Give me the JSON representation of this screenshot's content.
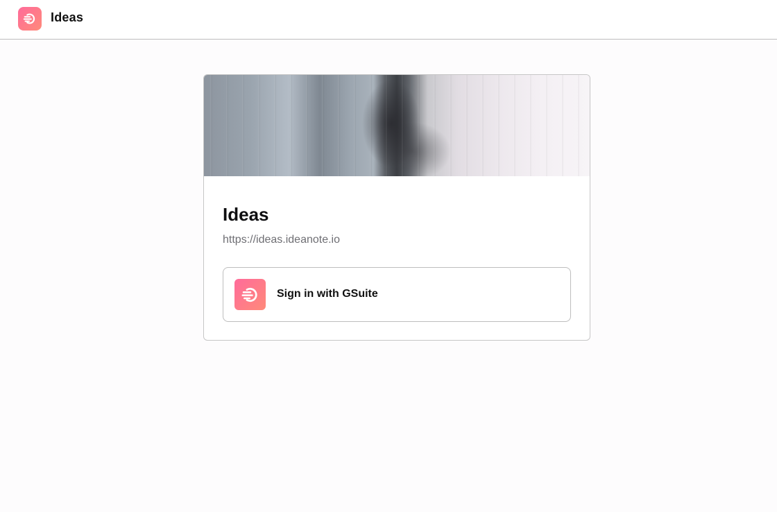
{
  "app": {
    "title": "Ideas",
    "logo_icon": "ideanote-logo-icon",
    "brand_color_start": "#ff6b9a",
    "brand_color_end": "#ff8a7a"
  },
  "card": {
    "cover_image": "rainy-window-cover-image",
    "title": "Ideas",
    "url": "https://ideas.ideanote.io",
    "signin": {
      "label": "Sign in with GSuite",
      "icon": "ideanote-logo-icon"
    }
  }
}
